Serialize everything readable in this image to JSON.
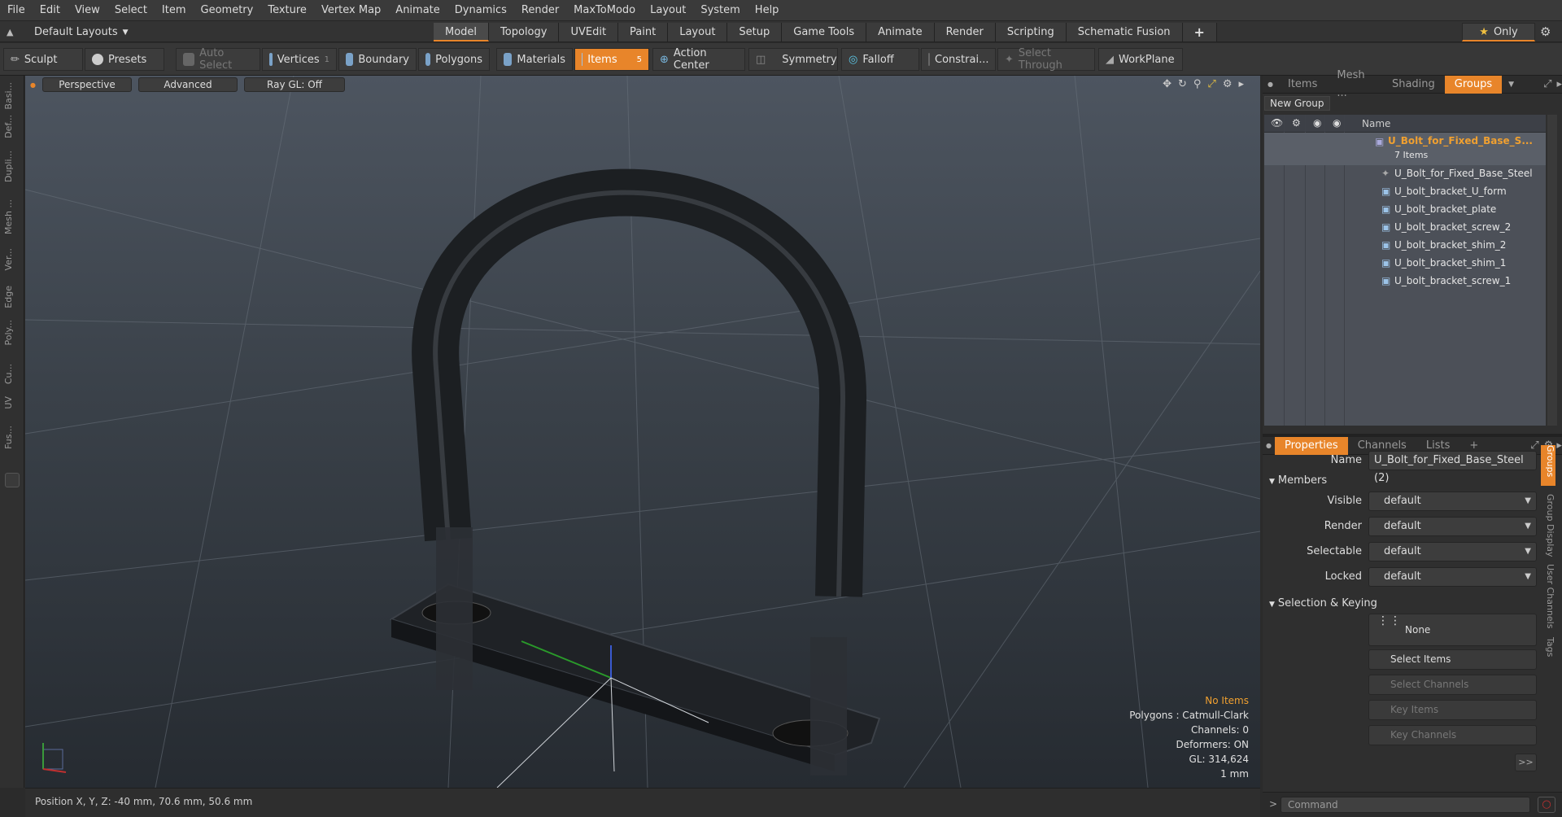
{
  "menu": [
    "File",
    "Edit",
    "View",
    "Select",
    "Item",
    "Geometry",
    "Texture",
    "Vertex Map",
    "Animate",
    "Dynamics",
    "Render",
    "MaxToModo",
    "Layout",
    "System",
    "Help"
  ],
  "layout_selector": "Default Layouts",
  "layout_tabs": [
    "Model",
    "Topology",
    "UVEdit",
    "Paint",
    "Layout",
    "Setup",
    "Game Tools",
    "Animate",
    "Render",
    "Scripting",
    "Schematic Fusion"
  ],
  "active_layout_tab": "Model",
  "only_label": "Only",
  "toolbar": {
    "sculpt": "Sculpt",
    "presets": "Presets",
    "auto_select": "Auto Select",
    "vertices": "Vertices",
    "vertices_count": "1",
    "boundary": "Boundary",
    "polygons": "Polygons",
    "materials": "Materials",
    "items": "Items",
    "items_count": "5",
    "action_center": "Action Center",
    "symmetry": "Symmetry",
    "falloff": "Falloff",
    "constraints": "Constrai...",
    "select_through": "Select Through",
    "workplane": "WorkPlane"
  },
  "left_tabs": [
    "Basi...",
    "Def...",
    "Dupli...",
    "Mesh ...",
    "Ver...",
    "Edge",
    "Poly...",
    "Cu...",
    "UV",
    "Fus..."
  ],
  "viewport": {
    "view_mode": "Perspective",
    "advanced": "Advanced",
    "ray_gl": "Ray GL: Off",
    "info": {
      "no_items": "No Items",
      "polygons": "Polygons : Catmull-Clark",
      "channels": "Channels: 0",
      "deformers": "Deformers: ON",
      "gl": "GL: 314,624",
      "scale": "1 mm"
    }
  },
  "status": "Position X, Y, Z:  -40 mm, 70.6 mm, 50.6 mm",
  "groups_panel": {
    "tabs": [
      "Items",
      "Mesh ...",
      "Shading",
      "Groups"
    ],
    "active_tab": "Groups",
    "new_group": "New Group",
    "name_header": "Name",
    "group_name": "U_Bolt_for_Fixed_Base_S...",
    "group_count": "7 Items",
    "items": [
      "U_Bolt_for_Fixed_Base_Steel",
      "U_bolt_bracket_U_form",
      "U_bolt_bracket_plate",
      "U_bolt_bracket_screw_2",
      "U_bolt_bracket_shim_2",
      "U_bolt_bracket_shim_1",
      "U_bolt_bracket_screw_1"
    ]
  },
  "properties_panel": {
    "tabs": [
      "Properties",
      "Channels",
      "Lists",
      "+"
    ],
    "active_tab": "Properties",
    "name_label": "Name",
    "name_value": "U_Bolt_for_Fixed_Base_Steel (2)",
    "members_section": "Members",
    "fields": [
      {
        "label": "Visible",
        "value": "default"
      },
      {
        "label": "Render",
        "value": "default"
      },
      {
        "label": "Selectable",
        "value": "default"
      },
      {
        "label": "Locked",
        "value": "default"
      }
    ],
    "selection_section": "Selection & Keying",
    "none_label": "None",
    "select_items": "Select Items",
    "select_channels": "Select Channels",
    "key_items": "Key Items",
    "key_channels": "Key Channels",
    "more": ">>",
    "side_tabs": [
      "Groups",
      "Group Display",
      "User Channels",
      "Tags"
    ]
  },
  "command_placeholder": "Command"
}
